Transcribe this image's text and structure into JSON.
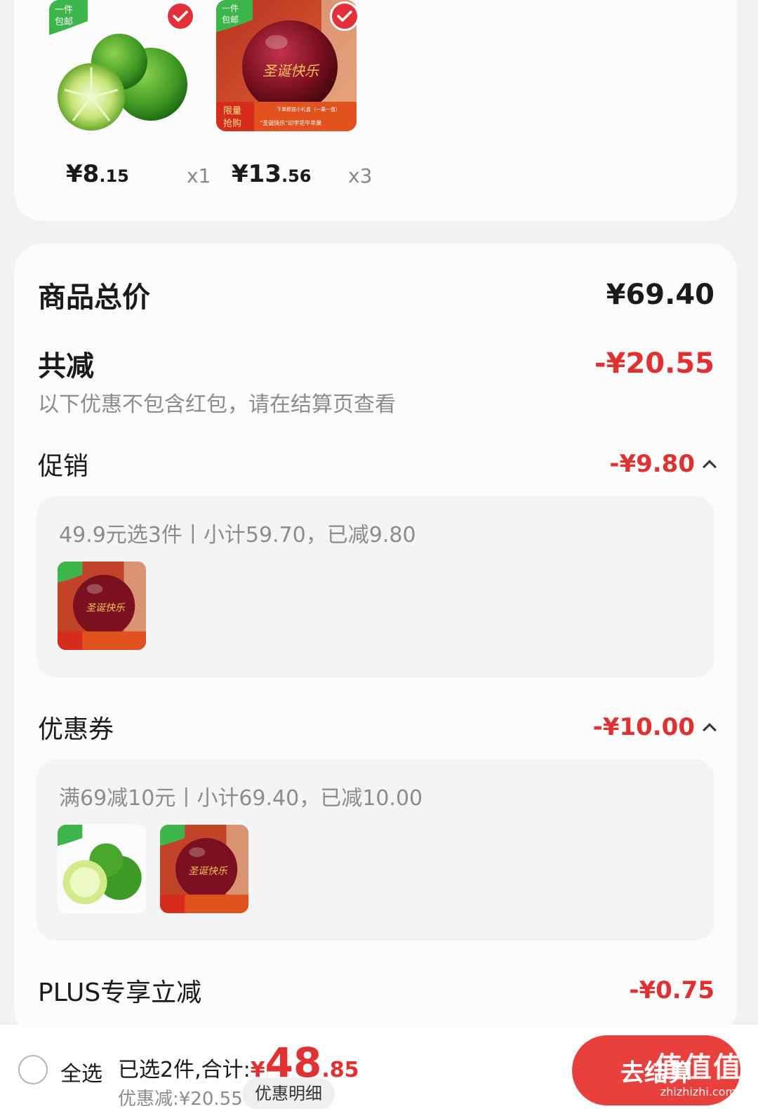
{
  "items": [
    {
      "price_int": "¥8",
      "price_dec": ".15",
      "qty": "x1",
      "badge": "一件\n包邮",
      "image": "lime-icon"
    },
    {
      "price_int": "¥13",
      "price_dec": ".56",
      "qty": "x3",
      "badge": "一件\n包邮",
      "image": "apple-icon",
      "caption_left": "限量\n抢购",
      "caption_right": "“圣诞快乐”印字花牛苹果",
      "caption_top": "下单即送小礼盒（一果一盒）"
    }
  ],
  "summary": {
    "total_label": "商品总价",
    "total_value": "¥69.40",
    "reduce_label": "共减",
    "reduce_value": "-¥20.55",
    "note": "以下优惠不包含红包，请在结算页查看",
    "promo_label": "促销",
    "promo_value": "-¥9.80",
    "promo_desc": "49.9元选3件丨小计59.70，已减9.80",
    "coupon_label": "优惠券",
    "coupon_value": "-¥10.00",
    "coupon_desc": "满69减10元丨小计69.40，已减10.00",
    "plus_label": "PLUS专享立减",
    "plus_value": "-¥0.75"
  },
  "bottom": {
    "select_all": "全选",
    "selected_prefix": "已选2件,合计:",
    "total_yen": "¥",
    "total_int": "48",
    "total_dec": ".85",
    "discount": "优惠减:¥20.55",
    "detail_button": "优惠明细",
    "checkout_button": "去结算"
  },
  "watermark": {
    "big": "值值值",
    "small": "zhizhizhi.com"
  },
  "colors": {
    "accent": "#e03030",
    "button": "#e8403c",
    "badge_green": "#3cb64a"
  }
}
